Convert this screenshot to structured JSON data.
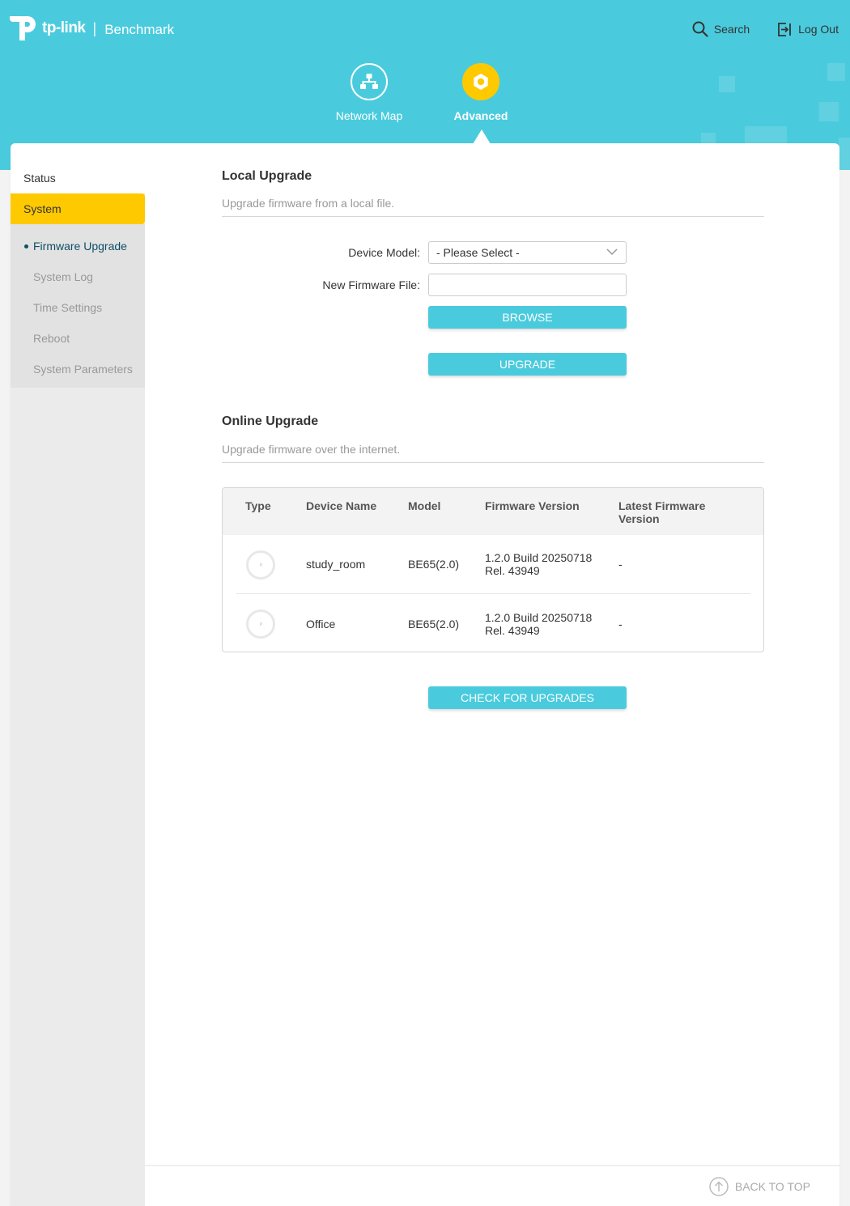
{
  "header": {
    "brand": "tp-link",
    "separator": "|",
    "app_name": "Benchmark",
    "search_label": "Search",
    "logout_label": "Log Out",
    "nav": [
      {
        "label": "Network Map",
        "icon": "network-map-icon",
        "active": false
      },
      {
        "label": "Advanced",
        "icon": "gear-icon",
        "active": true
      }
    ]
  },
  "sidebar": {
    "items": [
      {
        "label": "Status",
        "active": false
      },
      {
        "label": "System",
        "active": true
      }
    ],
    "sub_items": [
      {
        "label": "Firmware Upgrade",
        "active": true
      },
      {
        "label": "System Log",
        "active": false
      },
      {
        "label": "Time Settings",
        "active": false
      },
      {
        "label": "Reboot",
        "active": false
      },
      {
        "label": "System Parameters",
        "active": false
      }
    ]
  },
  "local_upgrade": {
    "title": "Local Upgrade",
    "description": "Upgrade firmware from a local file.",
    "device_model_label": "Device Model:",
    "device_model_value": "- Please Select -",
    "firmware_file_label": "New Firmware File:",
    "firmware_file_value": "",
    "browse_label": "BROWSE",
    "upgrade_label": "UPGRADE"
  },
  "online_upgrade": {
    "title": "Online Upgrade",
    "description": "Upgrade firmware over the internet.",
    "columns": [
      "Type",
      "Device Name",
      "Model",
      "Firmware Version",
      "Latest Firmware Version"
    ],
    "rows": [
      {
        "device_name": "study_room",
        "model": "BE65(2.0)",
        "firmware_version": "1.2.0 Build 20250718 Rel. 43949",
        "latest_firmware_version": "-"
      },
      {
        "device_name": "Office",
        "model": "BE65(2.0)",
        "firmware_version": "1.2.0 Build 20250718 Rel. 43949",
        "latest_firmware_version": "-"
      }
    ],
    "check_label": "CHECK FOR UPGRADES"
  },
  "footer": {
    "back_to_top_label": "BACK TO TOP"
  },
  "colors": {
    "header_bg": "#4acbdd",
    "accent_yellow": "#ffc900",
    "button_bg": "#4acbdd",
    "active_sub_text": "#0e4e66"
  }
}
